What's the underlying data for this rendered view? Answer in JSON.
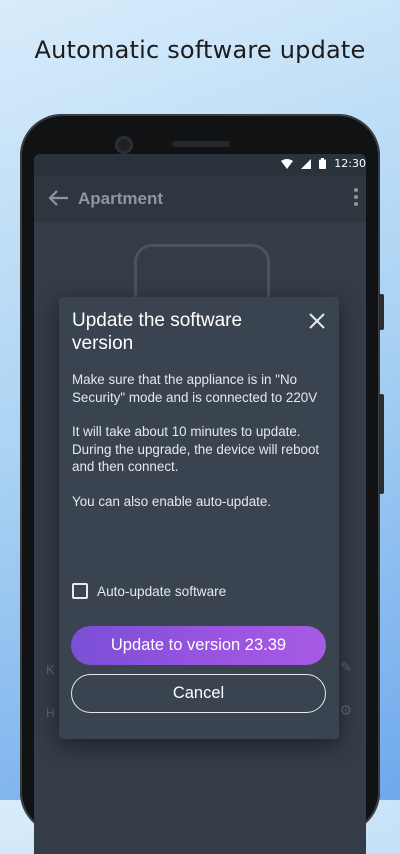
{
  "headline": "Automatic software update",
  "status_bar": {
    "time": "12:30",
    "icons": [
      "wifi-icon",
      "signal-icon",
      "battery-icon"
    ]
  },
  "app_bar": {
    "title": "Apartment",
    "icons": [
      "back-arrow-icon",
      "more-vert-icon"
    ]
  },
  "background_rows": {
    "row1_label": "K",
    "row2_label": "H"
  },
  "dialog": {
    "title": "Update the software version",
    "paragraphs": [
      "Make sure that the appliance is in \"No Security\" mode and is connected to 220V",
      "It will take about 10 minutes to update. During the upgrade, the device will reboot and then connect.",
      "You can also enable auto-update."
    ],
    "checkbox_label": "Auto-update software",
    "checkbox_checked": false,
    "primary_button": "Update to version 23.39",
    "secondary_button": "Cancel"
  },
  "colors": {
    "dialog_bg": "#3a4350",
    "screen_bg": "#333c47",
    "accent_gradient_start": "#7a4fd6",
    "accent_gradient_end": "#a65be4"
  }
}
